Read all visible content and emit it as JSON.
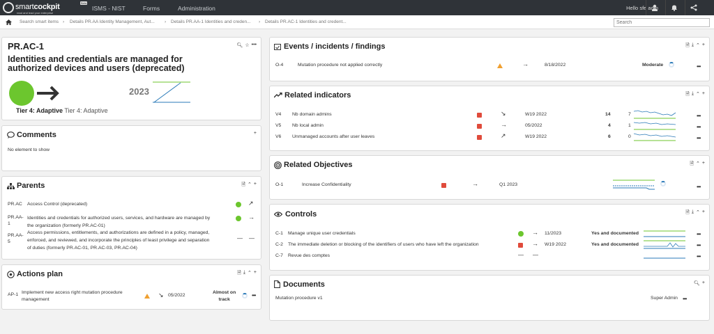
{
  "topbar": {
    "logo_a": "smart",
    "logo_b": "cockpit",
    "tagline": "read and lead your enterprise",
    "beta": "Beta",
    "nav": [
      "ISMS - NIST",
      "Forms",
      "Administration"
    ],
    "user": "Hello sfe adm"
  },
  "breadcrumb": [
    "Search smart items",
    "Details PR.AA Identity Management, Aut...",
    "Details PR.AA-1 Identities and creden...",
    "Details PR.AC-1 Identities and credent..."
  ],
  "search": {
    "placeholder": "Search"
  },
  "item": {
    "code": "PR.AC-1",
    "title_line1": "Identities and credentials are managed for",
    "title_line2": "authorized devices and users (deprecated)",
    "year": "2023",
    "tier_bold": "Tier 4: Adaptive",
    "tier_text": "Tier 4: Adaptive"
  },
  "comments": {
    "title": "Comments",
    "empty": "No element to show"
  },
  "parents": {
    "title": "Parents",
    "rows": [
      {
        "code": "PR.AC",
        "label": "Access Control (deprecated)",
        "arrow": "↗"
      },
      {
        "code": "PR.AA-1",
        "line1": "Identities and credentials for authorized users, services, and hardware are managed by",
        "line2": "the organization (formerly PR.AC-01)",
        "arrow": "→"
      },
      {
        "code": "PR.AA-5",
        "line1": "Access permissions, entitlements, and authorizations are defined in a policy, managed,",
        "line2": "enforced, and reviewed, and incorporate the principles of least privilege and separation",
        "line3": "of duties (formerly PR.AC-01, PR.AC-03, PR.AC-04)"
      }
    ]
  },
  "actions": {
    "title": "Actions plan",
    "rows": [
      {
        "code": "AP-1",
        "line1": "Implement new access right mutation procedure",
        "line2": "management",
        "date": "05/2022",
        "status_line1": "Almost on",
        "status_line2": "track"
      }
    ]
  },
  "events": {
    "title": "Events / incidents / findings",
    "rows": [
      {
        "code": "O-4",
        "label": "Mutation procedure not applied correctly",
        "date": "8/18/2022",
        "level": "Moderate"
      }
    ]
  },
  "indicators": {
    "title": "Related indicators",
    "rows": [
      {
        "code": "V4",
        "label": "Nb domain admins",
        "date": "W19 2022",
        "value": "14",
        "target": "7",
        "arrow": "↘"
      },
      {
        "code": "V5",
        "label": "Nb local admin",
        "date": "05/2022",
        "value": "4",
        "target": "1",
        "arrow": "→"
      },
      {
        "code": "V6",
        "label": "Unmanaged accounts after user leaves",
        "date": "W19 2022",
        "value": "6",
        "target": "0",
        "arrow": "↗"
      }
    ]
  },
  "objectives": {
    "title": "Related Objectives",
    "rows": [
      {
        "code": "O-1",
        "label": "Increase Confidentiality",
        "date": "Q1 2023"
      }
    ]
  },
  "controls": {
    "title": "Controls",
    "rows": [
      {
        "code": "C-1",
        "label": "Manage unique user credentials",
        "date": "11/2023",
        "status": "Yes and documented"
      },
      {
        "code": "C-2",
        "label": "The immediate deletion or blocking of the identifiers of users who have left the organization",
        "date": "W19 2022",
        "status": "Yes and documented"
      },
      {
        "code": "C-7",
        "label": "Revue des comptes"
      }
    ]
  },
  "documents": {
    "title": "Documents",
    "rows": [
      {
        "label": "Mutation procedure v1",
        "owner": "Super Admin"
      }
    ]
  },
  "colors": {
    "green": "#6cc62e",
    "red": "#e04b3b",
    "orange": "#f0a030",
    "blue": "#2a7ab8",
    "topbar": "#2f3338"
  }
}
